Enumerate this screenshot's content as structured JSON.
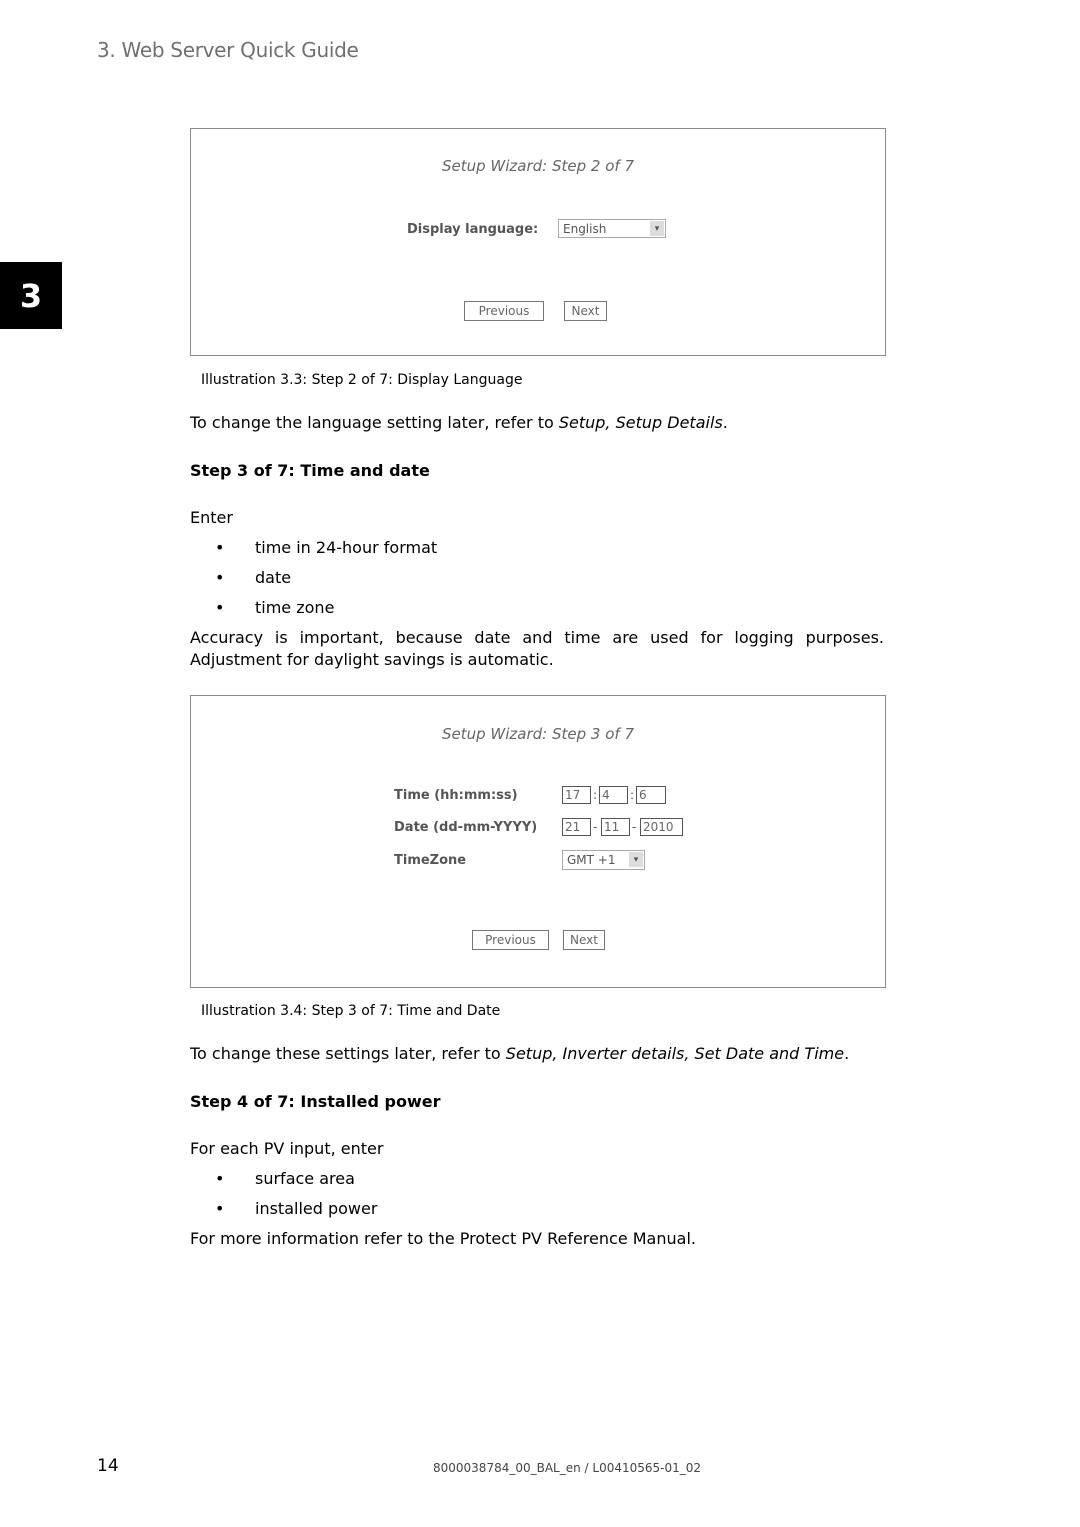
{
  "header": {
    "title": "3. Web Server Quick Guide",
    "chapter_tab": "3"
  },
  "screenshot1": {
    "title": "Setup Wizard: Step 2 of 7",
    "language_label": "Display language:",
    "language_value": "English",
    "previous_label": "Previous",
    "next_label": "Next"
  },
  "caption1": "Illustration 3.3: Step 2 of 7: Display Language",
  "para1": {
    "text": "To change the language setting later, refer to ",
    "link": "Setup, Setup Details",
    "end": "."
  },
  "step3": {
    "heading": "Step 3 of 7: Time and date",
    "intro": "Enter",
    "bullets": [
      "time in 24-hour format",
      "date",
      "time zone"
    ],
    "accuracy": "Accuracy is important, because date and time are used for logging purposes. Adjustment for daylight savings is automatic."
  },
  "screenshot2": {
    "title": "Setup Wizard: Step 3 of 7",
    "time_label": "Time (hh:mm:ss)",
    "time": {
      "hh": "17",
      "mm": "4",
      "ss": "6"
    },
    "date_label": "Date (dd-mm-YYYY)",
    "date": {
      "dd": "21",
      "mm": "11",
      "yyyy": "2010"
    },
    "timezone_label": "TimeZone",
    "timezone_value": "GMT +1",
    "previous_label": "Previous",
    "next_label": "Next",
    "time_sep": ":",
    "date_sep": "-"
  },
  "caption2": "Illustration 3.4: Step 3 of 7: Time and Date",
  "para2": {
    "text": "To change these settings later, refer to ",
    "link": "Setup, Inverter details, Set Date and Time",
    "end": "."
  },
  "step4": {
    "heading": "Step 4 of 7: Installed power",
    "intro": "For each PV input, enter",
    "bullets": [
      "surface area",
      "installed power"
    ],
    "more": "For more information refer to the Protect PV Reference Manual."
  },
  "footer": {
    "page_number": "14",
    "doc_id": "8000038784_00_BAL_en / L00410565-01_02"
  },
  "bullet_char": "•",
  "arrow_char": "▾"
}
